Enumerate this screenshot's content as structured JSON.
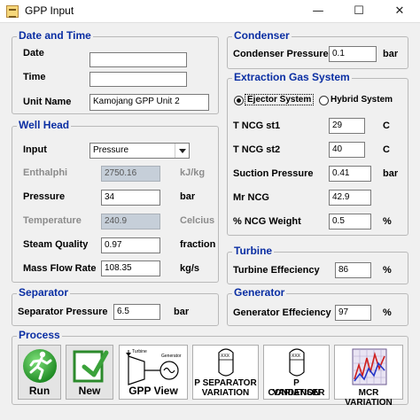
{
  "window": {
    "title": "GPP Input",
    "min": "—",
    "max": "☐",
    "close": "✕"
  },
  "date_time": {
    "title": "Date and Time",
    "date_label": "Date",
    "date_value": "",
    "time_label": "Time",
    "time_value": "",
    "unit_name_label": "Unit Name",
    "unit_name_value": "Kamojang GPP Unit 2"
  },
  "well_head": {
    "title": "Well Head",
    "input_label": "Input",
    "input_value": "Pressure",
    "enthalphi_label": "Enthalphi",
    "enthalphi_value": "2750.16",
    "enthalphi_unit": "kJ/kg",
    "pressure_label": "Pressure",
    "pressure_value": "34",
    "pressure_unit": "bar",
    "temperature_label": "Temperature",
    "temperature_value": "240.9",
    "temperature_unit": "Celcius",
    "steam_quality_label": "Steam Quality",
    "steam_quality_value": "0.97",
    "steam_quality_unit": "fraction",
    "mass_flow_label": "Mass Flow Rate",
    "mass_flow_value": "108.35",
    "mass_flow_unit": "kg/s"
  },
  "separator": {
    "title": "Separator",
    "pressure_label": "Separator Pressure",
    "pressure_value": "6.5",
    "pressure_unit": "bar"
  },
  "condenser": {
    "title": "Condenser",
    "pressure_label": "Condenser Pressure",
    "pressure_value": "0.1",
    "pressure_unit": "bar"
  },
  "extraction": {
    "title": "Extraction Gas System",
    "ejector_label": "Ejector System",
    "ejector_selected": true,
    "hybrid_label": "Hybrid System",
    "hybrid_selected": false,
    "tncg1_label": "T NCG st1",
    "tncg1_value": "29",
    "tncg1_unit": "C",
    "tncg2_label": "T NCG st2",
    "tncg2_value": "40",
    "tncg2_unit": "C",
    "suction_label": "Suction Pressure",
    "suction_value": "0.41",
    "suction_unit": "bar",
    "mr_label": "Mr NCG",
    "mr_value": "42.9",
    "ncg_weight_label": "% NCG Weight",
    "ncg_weight_value": "0.5",
    "ncg_weight_unit": "%"
  },
  "turbine": {
    "title": "Turbine",
    "eff_label": "Turbine Effeciency",
    "eff_value": "86",
    "eff_unit": "%"
  },
  "generator": {
    "title": "Generator",
    "eff_label": "Generator Effeciency",
    "eff_value": "97",
    "eff_unit": "%"
  },
  "process": {
    "title": "Process",
    "run_label": "Run",
    "new_label": "New",
    "gpp_view_label": "GPP View",
    "gpp_turbine_text": "Turbine",
    "gpp_generator_text": "Generator",
    "p_sep_line1": "P SEPARATOR",
    "p_sep_line2": "VARIATION",
    "p_sep_icon_text": "XXX",
    "p_cond_line1": "P CONDENSER",
    "p_cond_line2": "VARIATION",
    "p_cond_icon_text": "XXX",
    "mcr_label": "MCR VARIATION"
  }
}
